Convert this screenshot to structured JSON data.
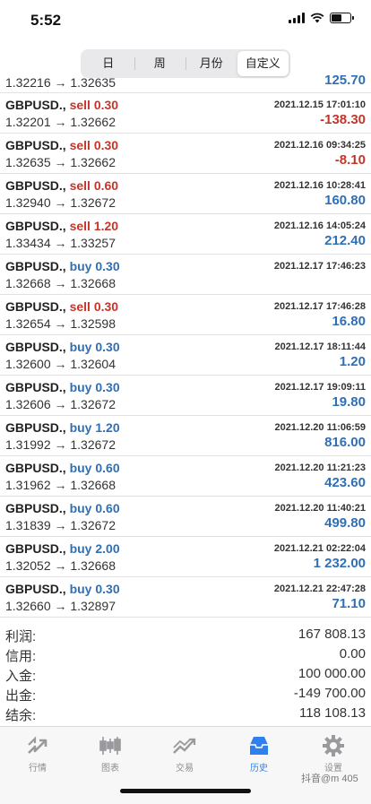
{
  "status": {
    "time": "5:52"
  },
  "segments": [
    {
      "label": "日"
    },
    {
      "label": "周"
    },
    {
      "label": "月份"
    },
    {
      "label": "自定义",
      "active": true
    }
  ],
  "trades": [
    {
      "symbol": "",
      "side": "",
      "lot": "",
      "date": "",
      "price": "1.32216 → 1.32635",
      "profit": "125.70",
      "sign": "pos",
      "partial": true
    },
    {
      "symbol": "GBPUSD.,",
      "side": "sell",
      "lot": "0.30",
      "date": "2021.12.15 17:01:10",
      "price": "1.32201 → 1.32662",
      "profit": "-138.30",
      "sign": "neg"
    },
    {
      "symbol": "GBPUSD.,",
      "side": "sell",
      "lot": "0.30",
      "date": "2021.12.16 09:34:25",
      "price": "1.32635 → 1.32662",
      "profit": "-8.10",
      "sign": "neg"
    },
    {
      "symbol": "GBPUSD.,",
      "side": "sell",
      "lot": "0.60",
      "date": "2021.12.16 10:28:41",
      "price": "1.32940 → 1.32672",
      "profit": "160.80",
      "sign": "pos"
    },
    {
      "symbol": "GBPUSD.,",
      "side": "sell",
      "lot": "1.20",
      "date": "2021.12.16 14:05:24",
      "price": "1.33434 → 1.33257",
      "profit": "212.40",
      "sign": "pos"
    },
    {
      "symbol": "GBPUSD.,",
      "side": "buy",
      "lot": "0.30",
      "date": "2021.12.17 17:46:23",
      "price": "1.32668 → 1.32668",
      "profit": "",
      "sign": "pos"
    },
    {
      "symbol": "GBPUSD.,",
      "side": "sell",
      "lot": "0.30",
      "date": "2021.12.17 17:46:28",
      "price": "1.32654 → 1.32598",
      "profit": "16.80",
      "sign": "pos"
    },
    {
      "symbol": "GBPUSD.,",
      "side": "buy",
      "lot": "0.30",
      "date": "2021.12.17 18:11:44",
      "price": "1.32600 → 1.32604",
      "profit": "1.20",
      "sign": "pos"
    },
    {
      "symbol": "GBPUSD.,",
      "side": "buy",
      "lot": "0.30",
      "date": "2021.12.17 19:09:11",
      "price": "1.32606 → 1.32672",
      "profit": "19.80",
      "sign": "pos"
    },
    {
      "symbol": "GBPUSD.,",
      "side": "buy",
      "lot": "1.20",
      "date": "2021.12.20 11:06:59",
      "price": "1.31992 → 1.32672",
      "profit": "816.00",
      "sign": "pos"
    },
    {
      "symbol": "GBPUSD.,",
      "side": "buy",
      "lot": "0.60",
      "date": "2021.12.20 11:21:23",
      "price": "1.31962 → 1.32668",
      "profit": "423.60",
      "sign": "pos"
    },
    {
      "symbol": "GBPUSD.,",
      "side": "buy",
      "lot": "0.60",
      "date": "2021.12.20 11:40:21",
      "price": "1.31839 → 1.32672",
      "profit": "499.80",
      "sign": "pos"
    },
    {
      "symbol": "GBPUSD.,",
      "side": "buy",
      "lot": "2.00",
      "date": "2021.12.21 02:22:04",
      "price": "1.32052 → 1.32668",
      "profit": "1 232.00",
      "sign": "pos"
    },
    {
      "symbol": "GBPUSD.,",
      "side": "buy",
      "lot": "0.30",
      "date": "2021.12.21 22:47:28",
      "price": "1.32660 → 1.32897",
      "profit": "71.10",
      "sign": "pos"
    }
  ],
  "summary": [
    {
      "label": "利润:",
      "value": "167 808.13"
    },
    {
      "label": "信用:",
      "value": "0.00"
    },
    {
      "label": "入金:",
      "value": "100 000.00"
    },
    {
      "label": "出金:",
      "value": "-149 700.00"
    },
    {
      "label": "结余:",
      "value": "118 108.13"
    }
  ],
  "tabs": [
    {
      "label": "行情",
      "icon": "quotes-icon"
    },
    {
      "label": "图表",
      "icon": "chart-icon"
    },
    {
      "label": "交易",
      "icon": "trade-icon"
    },
    {
      "label": "历史",
      "icon": "history-icon",
      "active": true
    },
    {
      "label": "设置",
      "icon": "gear-icon"
    }
  ],
  "colors": {
    "sell": "#c4352b",
    "buy": "#2f6fb5",
    "active_tab": "#2f80ed"
  },
  "watermark": "抖音@m 405"
}
